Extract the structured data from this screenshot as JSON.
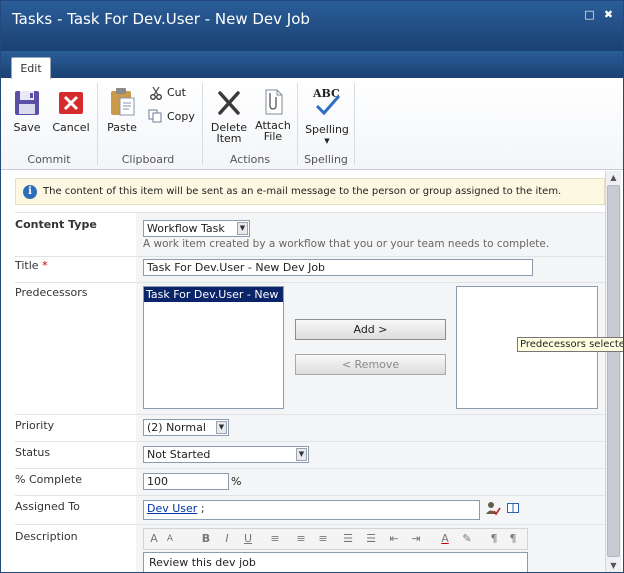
{
  "window": {
    "title": "Tasks - Task For Dev.User - New Dev Job",
    "minimize_glyph": "□",
    "close_glyph": "✖"
  },
  "ribbon": {
    "tab_label": "Edit",
    "groups": {
      "commit": {
        "label": "Commit",
        "save": "Save",
        "cancel": "Cancel"
      },
      "clipboard": {
        "label": "Clipboard",
        "paste": "Paste",
        "cut": "Cut",
        "copy": "Copy"
      },
      "actions": {
        "label": "Actions",
        "delete_line1": "Delete",
        "delete_line2": "Item",
        "attach_line1": "Attach",
        "attach_line2": "File"
      },
      "spelling": {
        "label": "Spelling",
        "spelling": "Spelling",
        "abc": "ABC"
      }
    }
  },
  "info": {
    "message": "The content of this item will be sent as an e-mail message to the person or group assigned to the item."
  },
  "form": {
    "content_type": {
      "label": "Content Type",
      "value": "Workflow Task",
      "description": "A work item created by a workflow that you or your team needs to complete."
    },
    "title": {
      "label": "Title",
      "required_mark": "*",
      "value": "Task For Dev.User - New Dev Job"
    },
    "predecessors": {
      "label": "Predecessors",
      "available_item": "Task For Dev.User - New Dev Job",
      "add_button": "Add >",
      "remove_button": "< Remove",
      "tooltip": "Predecessors selected values"
    },
    "priority": {
      "label": "Priority",
      "value": "(2) Normal"
    },
    "status": {
      "label": "Status",
      "value": "Not Started"
    },
    "percent_complete": {
      "label": "% Complete",
      "value": "100",
      "unit": "%"
    },
    "assigned_to": {
      "label": "Assigned To",
      "value": "Dev User",
      "suffix": " ;"
    },
    "description": {
      "label": "Description",
      "value": "Review this dev job",
      "toolbar": [
        "A",
        "A",
        "B",
        "I",
        "U",
        "≡",
        "≡",
        "≡",
        "☰",
        "☰",
        "⇤",
        "⇥",
        "A",
        "✎",
        "¶",
        "¶"
      ]
    }
  },
  "colors": {
    "title_bar": "#1f4c82",
    "info_bg": "#fcf8e1",
    "selected_item": "#0a246a",
    "required": "#c00000",
    "link": "#0033aa"
  }
}
